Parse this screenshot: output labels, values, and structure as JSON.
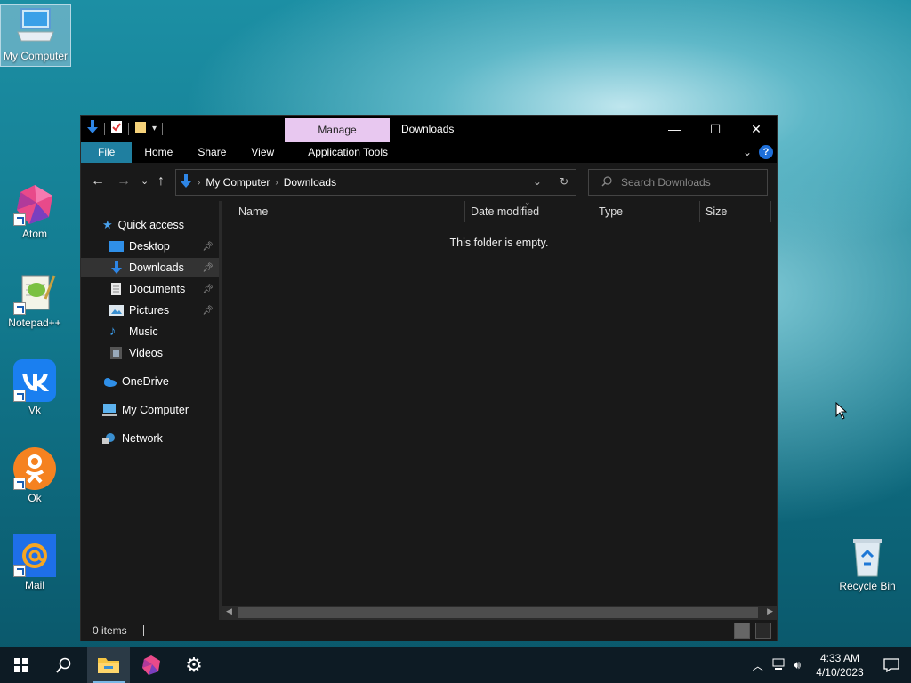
{
  "desktop": {
    "icons": [
      {
        "label": "My Computer"
      },
      {
        "label": "Atom"
      },
      {
        "label": "Notepad++"
      },
      {
        "label": "Vk"
      },
      {
        "label": "Ok"
      },
      {
        "label": "Mail"
      },
      {
        "label": "Recycle Bin"
      }
    ]
  },
  "window": {
    "title": "Downloads",
    "manage_tab": "Manage",
    "ribbon_tabs": [
      "File",
      "Home",
      "Share",
      "View",
      "Application Tools"
    ],
    "breadcrumb": [
      "My Computer",
      "Downloads"
    ],
    "search_placeholder": "Search Downloads",
    "columns": [
      "Name",
      "Date modified",
      "Type",
      "Size"
    ],
    "empty_message": "This folder is empty.",
    "status": "0 items",
    "sidebar": {
      "quick_access": "Quick access",
      "items": [
        "Desktop",
        "Downloads",
        "Documents",
        "Pictures",
        "Music",
        "Videos"
      ],
      "onedrive": "OneDrive",
      "my_computer": "My Computer",
      "network": "Network"
    }
  },
  "taskbar": {
    "time": "4:33 AM",
    "date": "4/10/2023"
  },
  "colors": {
    "manage_tab": "#e8c8f0",
    "file_tab": "#1f7fa0",
    "folder_blue": "#1e78d6"
  }
}
